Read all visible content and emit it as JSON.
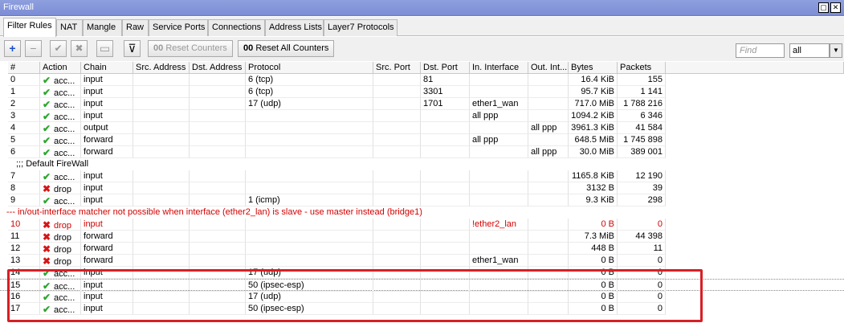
{
  "window": {
    "title": "Firewall",
    "restore_glyph": "▢",
    "close_glyph": "✕"
  },
  "tabs": [
    "Filter Rules",
    "NAT",
    "Mangle",
    "Raw",
    "Service Ports",
    "Connections",
    "Address Lists",
    "Layer7 Protocols"
  ],
  "toolbar": {
    "add_glyph": "+",
    "remove_glyph": "−",
    "enable_glyph": "✔",
    "disable_glyph": "✖",
    "comment_glyph": "▭",
    "filter_glyph": "⊽",
    "reset_counters_prefix": "00",
    "reset_counters_label": "Reset Counters",
    "reset_all_prefix": "00",
    "reset_all_label": "Reset All Counters",
    "find_placeholder": "Find",
    "filter_select_value": "all",
    "select_arrow": "▼"
  },
  "columns": [
    "#",
    "Action",
    "Chain",
    "Src. Address",
    "Dst. Address",
    "Protocol",
    "Src. Port",
    "Dst. Port",
    "In. Interface",
    "Out. Int...",
    "Bytes",
    "Packets"
  ],
  "colors": {
    "accept_icon": "#2fa52f",
    "drop_icon": "#d41616",
    "invalid_text": "#d40000",
    "highlight_box": "#d81f26"
  },
  "rows": [
    {
      "type": "rule",
      "num": "0",
      "icon": "✔",
      "action": "acc...",
      "chain": "input",
      "src": "",
      "dst": "",
      "proto": "6 (tcp)",
      "sport": "",
      "dport": "81",
      "inif": "",
      "outif": "",
      "bytes": "16.4 KiB",
      "packets": "155"
    },
    {
      "type": "rule",
      "num": "1",
      "icon": "✔",
      "action": "acc...",
      "chain": "input",
      "src": "",
      "dst": "",
      "proto": "6 (tcp)",
      "sport": "",
      "dport": "3301",
      "inif": "",
      "outif": "",
      "bytes": "95.7 KiB",
      "packets": "1 141"
    },
    {
      "type": "rule",
      "num": "2",
      "icon": "✔",
      "action": "acc...",
      "chain": "input",
      "src": "",
      "dst": "",
      "proto": "17 (udp)",
      "sport": "",
      "dport": "1701",
      "inif": "ether1_wan",
      "outif": "",
      "bytes": "717.0 MiB",
      "packets": "1 788 216"
    },
    {
      "type": "rule",
      "num": "3",
      "icon": "✔",
      "action": "acc...",
      "chain": "input",
      "src": "",
      "dst": "",
      "proto": "",
      "sport": "",
      "dport": "",
      "inif": "all ppp",
      "outif": "",
      "bytes": "1094.2 KiB",
      "packets": "6 346"
    },
    {
      "type": "rule",
      "num": "4",
      "icon": "✔",
      "action": "acc...",
      "chain": "output",
      "src": "",
      "dst": "",
      "proto": "",
      "sport": "",
      "dport": "",
      "inif": "",
      "outif": "all ppp",
      "bytes": "3961.3 KiB",
      "packets": "41 584"
    },
    {
      "type": "rule",
      "num": "5",
      "icon": "✔",
      "action": "acc...",
      "chain": "forward",
      "src": "",
      "dst": "",
      "proto": "",
      "sport": "",
      "dport": "",
      "inif": "all ppp",
      "outif": "",
      "bytes": "648.5 MiB",
      "packets": "1 745 898"
    },
    {
      "type": "rule",
      "num": "6",
      "icon": "✔",
      "action": "acc...",
      "chain": "forward",
      "src": "",
      "dst": "",
      "proto": "",
      "sport": "",
      "dport": "",
      "inif": "",
      "outif": "all ppp",
      "bytes": "30.0 MiB",
      "packets": "389 001"
    },
    {
      "type": "comment",
      "text": ";;; Default FireWall"
    },
    {
      "type": "rule",
      "num": "7",
      "icon": "✔",
      "action": "acc...",
      "chain": "input",
      "src": "",
      "dst": "",
      "proto": "",
      "sport": "",
      "dport": "",
      "inif": "",
      "outif": "",
      "bytes": "1165.8 KiB",
      "packets": "12 190"
    },
    {
      "type": "rule",
      "num": "8",
      "icon": "✖",
      "action": "drop",
      "chain": "input",
      "src": "",
      "dst": "",
      "proto": "",
      "sport": "",
      "dport": "",
      "inif": "",
      "outif": "",
      "bytes": "3132 B",
      "packets": "39"
    },
    {
      "type": "rule",
      "num": "9",
      "icon": "✔",
      "action": "acc...",
      "chain": "input",
      "src": "",
      "dst": "",
      "proto": "1 (icmp)",
      "sport": "",
      "dport": "",
      "inif": "",
      "outif": "",
      "bytes": "9.3 KiB",
      "packets": "298"
    },
    {
      "type": "warning",
      "text": "--- in/out-interface matcher not possible when interface (ether2_lan) is slave - use master instead (bridge1)"
    },
    {
      "type": "rule",
      "red": true,
      "num": "10",
      "icon": "✖",
      "action": "drop",
      "chain": "input",
      "src": "",
      "dst": "",
      "proto": "",
      "sport": "",
      "dport": "",
      "inif": "!ether2_lan",
      "outif": "",
      "bytes": "0 B",
      "packets": "0"
    },
    {
      "type": "rule",
      "num": "11",
      "icon": "✖",
      "action": "drop",
      "chain": "forward",
      "src": "",
      "dst": "",
      "proto": "",
      "sport": "",
      "dport": "",
      "inif": "",
      "outif": "",
      "bytes": "7.3 MiB",
      "packets": "44 398"
    },
    {
      "type": "rule",
      "num": "12",
      "icon": "✖",
      "action": "drop",
      "chain": "forward",
      "src": "",
      "dst": "",
      "proto": "",
      "sport": "",
      "dport": "",
      "inif": "",
      "outif": "",
      "bytes": "448 B",
      "packets": "11"
    },
    {
      "type": "rule",
      "num": "13",
      "icon": "✖",
      "action": "drop",
      "chain": "forward",
      "src": "",
      "dst": "",
      "proto": "",
      "sport": "",
      "dport": "",
      "inif": "ether1_wan",
      "outif": "",
      "bytes": "0 B",
      "packets": "0"
    },
    {
      "type": "rule",
      "num": "14",
      "icon": "✔",
      "action": "acc...",
      "chain": "input",
      "src": "",
      "dst": "",
      "proto": "17 (udp)",
      "sport": "",
      "dport": "",
      "inif": "",
      "outif": "",
      "bytes": "0 B",
      "packets": "0"
    },
    {
      "type": "rule",
      "selected": true,
      "num": "15",
      "icon": "✔",
      "action": "acc...",
      "chain": "input",
      "src": "",
      "dst": "",
      "proto": "50 (ipsec-esp)",
      "sport": "",
      "dport": "",
      "inif": "",
      "outif": "",
      "bytes": "0 B",
      "packets": "0"
    },
    {
      "type": "rule",
      "num": "16",
      "icon": "✔",
      "action": "acc...",
      "chain": "input",
      "src": "",
      "dst": "",
      "proto": "17 (udp)",
      "sport": "",
      "dport": "",
      "inif": "",
      "outif": "",
      "bytes": "0 B",
      "packets": "0"
    },
    {
      "type": "rule",
      "num": "17",
      "icon": "✔",
      "action": "acc...",
      "chain": "input",
      "src": "",
      "dst": "",
      "proto": "50 (ipsec-esp)",
      "sport": "",
      "dport": "",
      "inif": "",
      "outif": "",
      "bytes": "0 B",
      "packets": "0"
    }
  ]
}
